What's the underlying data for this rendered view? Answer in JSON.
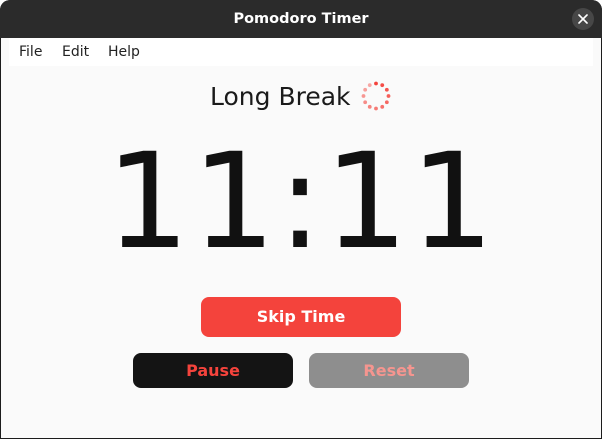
{
  "window": {
    "title": "Pomodoro Timer"
  },
  "menu": {
    "items": [
      {
        "label": "File"
      },
      {
        "label": "Edit"
      },
      {
        "label": "Help"
      }
    ]
  },
  "timer": {
    "mode": "Long Break",
    "time": "11:11"
  },
  "buttons": {
    "skip": "Skip Time",
    "pause": "Pause",
    "reset": "Reset"
  },
  "colors": {
    "accent": "#f4433c",
    "titlebar": "#2b2b2b",
    "background": "#fafafa",
    "pause_bg": "#141414",
    "reset_bg": "#8e8e8e"
  },
  "icons": {
    "close": "close-icon",
    "spinner": "loading-spinner-icon"
  }
}
